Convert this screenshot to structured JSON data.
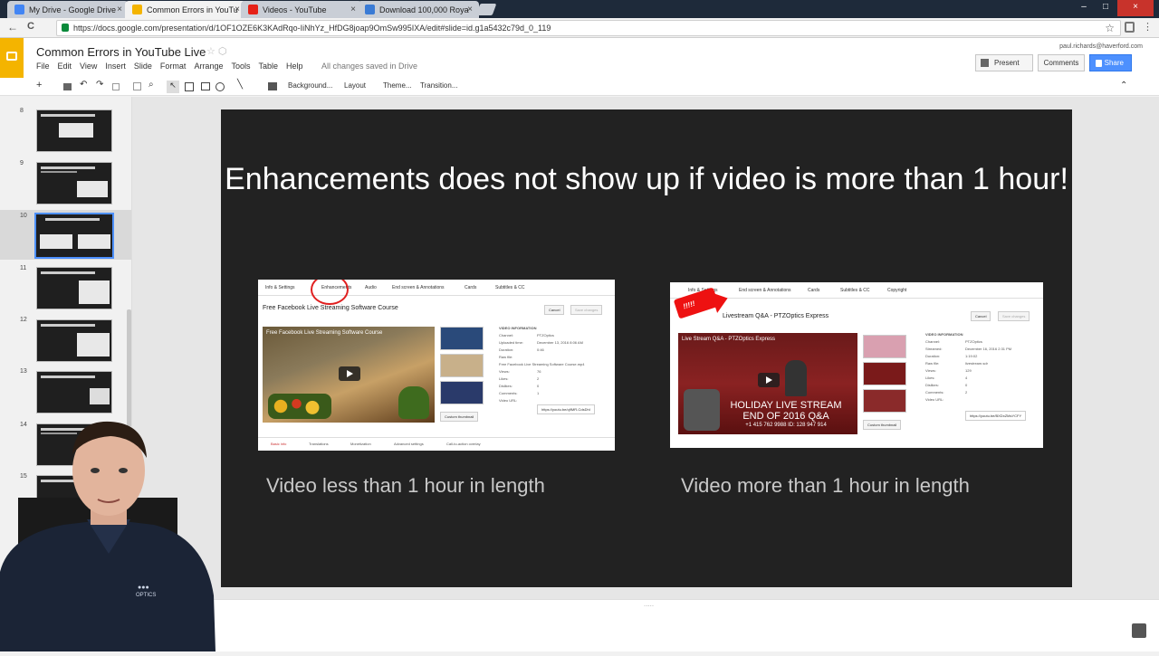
{
  "browser": {
    "tabs": [
      {
        "title": "My Drive - Google Drive",
        "color": "#4285f4"
      },
      {
        "title": "Common Errors in YouTu",
        "color": "#f4b400"
      },
      {
        "title": "Videos - YouTube",
        "color": "#e62117"
      },
      {
        "title": "Download 100,000 Roya",
        "color": "#3a7bd5"
      }
    ],
    "close_glyph": "×",
    "url": "https://docs.google.com/presentation/d/1OF1OZE6K3KAdRqo-IiNhYz_HfDG8joap9OmSw995IXA/edit#slide=id.g1a5432c79d_0_119",
    "back_glyph": "←",
    "reload_glyph": "C",
    "bookmark_glyph": "☆",
    "window_controls": [
      "–",
      "□",
      "×"
    ]
  },
  "docs": {
    "title": "Common Errors in YouTube Live",
    "title_icons": "☆ ⬡",
    "menus": [
      "File",
      "Edit",
      "View",
      "Insert",
      "Slide",
      "Format",
      "Arrange",
      "Tools",
      "Table",
      "Help"
    ],
    "save_status": "All changes saved in Drive",
    "user_email": "paul.richards@haverford.com",
    "present_label": "Present",
    "comments_label": "Comments",
    "share_label": "Share"
  },
  "toolbar": {
    "new_glyph": "+",
    "background_label": "Background...",
    "layout_label": "Layout",
    "theme_label": "Theme...",
    "transition_label": "Transition...",
    "collapse_glyph": "⌃"
  },
  "filmstrip": {
    "slides": [
      "8",
      "9",
      "10",
      "11",
      "12",
      "13",
      "14",
      "15"
    ],
    "selected": "10"
  },
  "slide": {
    "title": "Enhancements does not show up if video is more than 1 hour!",
    "left_caption": "Video less than 1 hour in length",
    "right_caption": "Video more than 1 hour in length",
    "left_shot": {
      "tabs": [
        "Info & Settings",
        "Enhancements",
        "Audio",
        "End screen & Annotations",
        "Cards",
        "Subtitles & CC"
      ],
      "video_title": "Free Facebook Live Streaming Software Course",
      "player_title": "Free Facebook Live Streaming Software Course",
      "cancel": "Cancel",
      "save": "Save changes",
      "info": [
        "VIDEO INFORMATION",
        "Channel:",
        "Uploaded time:",
        "Duration:",
        "Raw file:",
        "Views:",
        "Likes:",
        "Dislikes:",
        "Comments:",
        "Video URL:"
      ],
      "info_values": [
        "PTZOptics",
        "December 13, 2016 8:06 AM",
        "0:46",
        "Free Facebook Live Streaming Software Course.mp4",
        "76",
        "2",
        "0",
        "1"
      ],
      "video_url": "https://youtu.be/q9MR-CdsDhI",
      "custom_thumb": "Custom thumbnail",
      "bottom_tabs": [
        "Basic info",
        "Translations",
        "Monetization",
        "Advanced settings",
        "Call-to-action overlay"
      ]
    },
    "right_shot": {
      "tabs": [
        "Info & Settings",
        "End screen & Annotations",
        "Cards",
        "Subtitles & CC",
        "Copyright"
      ],
      "video_title": "Livestream Q&A - PTZOptics Express",
      "player_title": "Live Stream Q&A - PTZOptics Express",
      "banner_line1": "HOLIDAY LIVE STREAM",
      "banner_line2": "END OF 2016 Q&A",
      "banner_line3": "+1 415 762 9988 ID: 128 947 914",
      "callout_text": "!!!!!",
      "cancel": "Cancel",
      "save": "Save changes",
      "info": [
        "VIDEO INFORMATION",
        "Channel:",
        "Streamed:",
        "Duration:",
        "Raw file:",
        "Views:",
        "Likes:",
        "Dislikes:",
        "Comments:",
        "Video URL:"
      ],
      "info_values": [
        "PTZOptics",
        "December 16, 2016 2:31 PM",
        "1:19:02",
        "livestream.sdr",
        "129",
        "4",
        "0",
        "2"
      ],
      "video_url": "https://youtu.be/BXDxZMsYCFY",
      "custom_thumb": "Custom thumbnail"
    }
  },
  "notes": {
    "grip": "....."
  },
  "webcam": {
    "shirt_logo": "OPTICS",
    "shirt_mark": "●●●"
  }
}
